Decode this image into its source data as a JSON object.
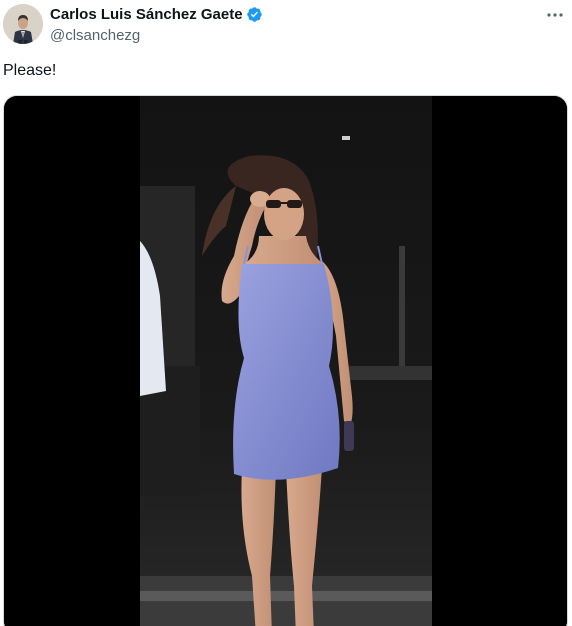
{
  "tweet": {
    "author": {
      "display_name": "Carlos Luis Sánchez Gaete",
      "handle": "@clsanchezg",
      "verified": true,
      "avatar_icon": "avatar-photo"
    },
    "text": "Please!",
    "more_icon": "more-options-icon",
    "media": {
      "type": "animated-gif",
      "description_icon": "gif-media"
    }
  },
  "colors": {
    "text_primary": "#0f1419",
    "text_secondary": "#536471",
    "verified_blue": "#1d9bf0",
    "media_background": "#000000",
    "dress": "#8a93d6"
  }
}
